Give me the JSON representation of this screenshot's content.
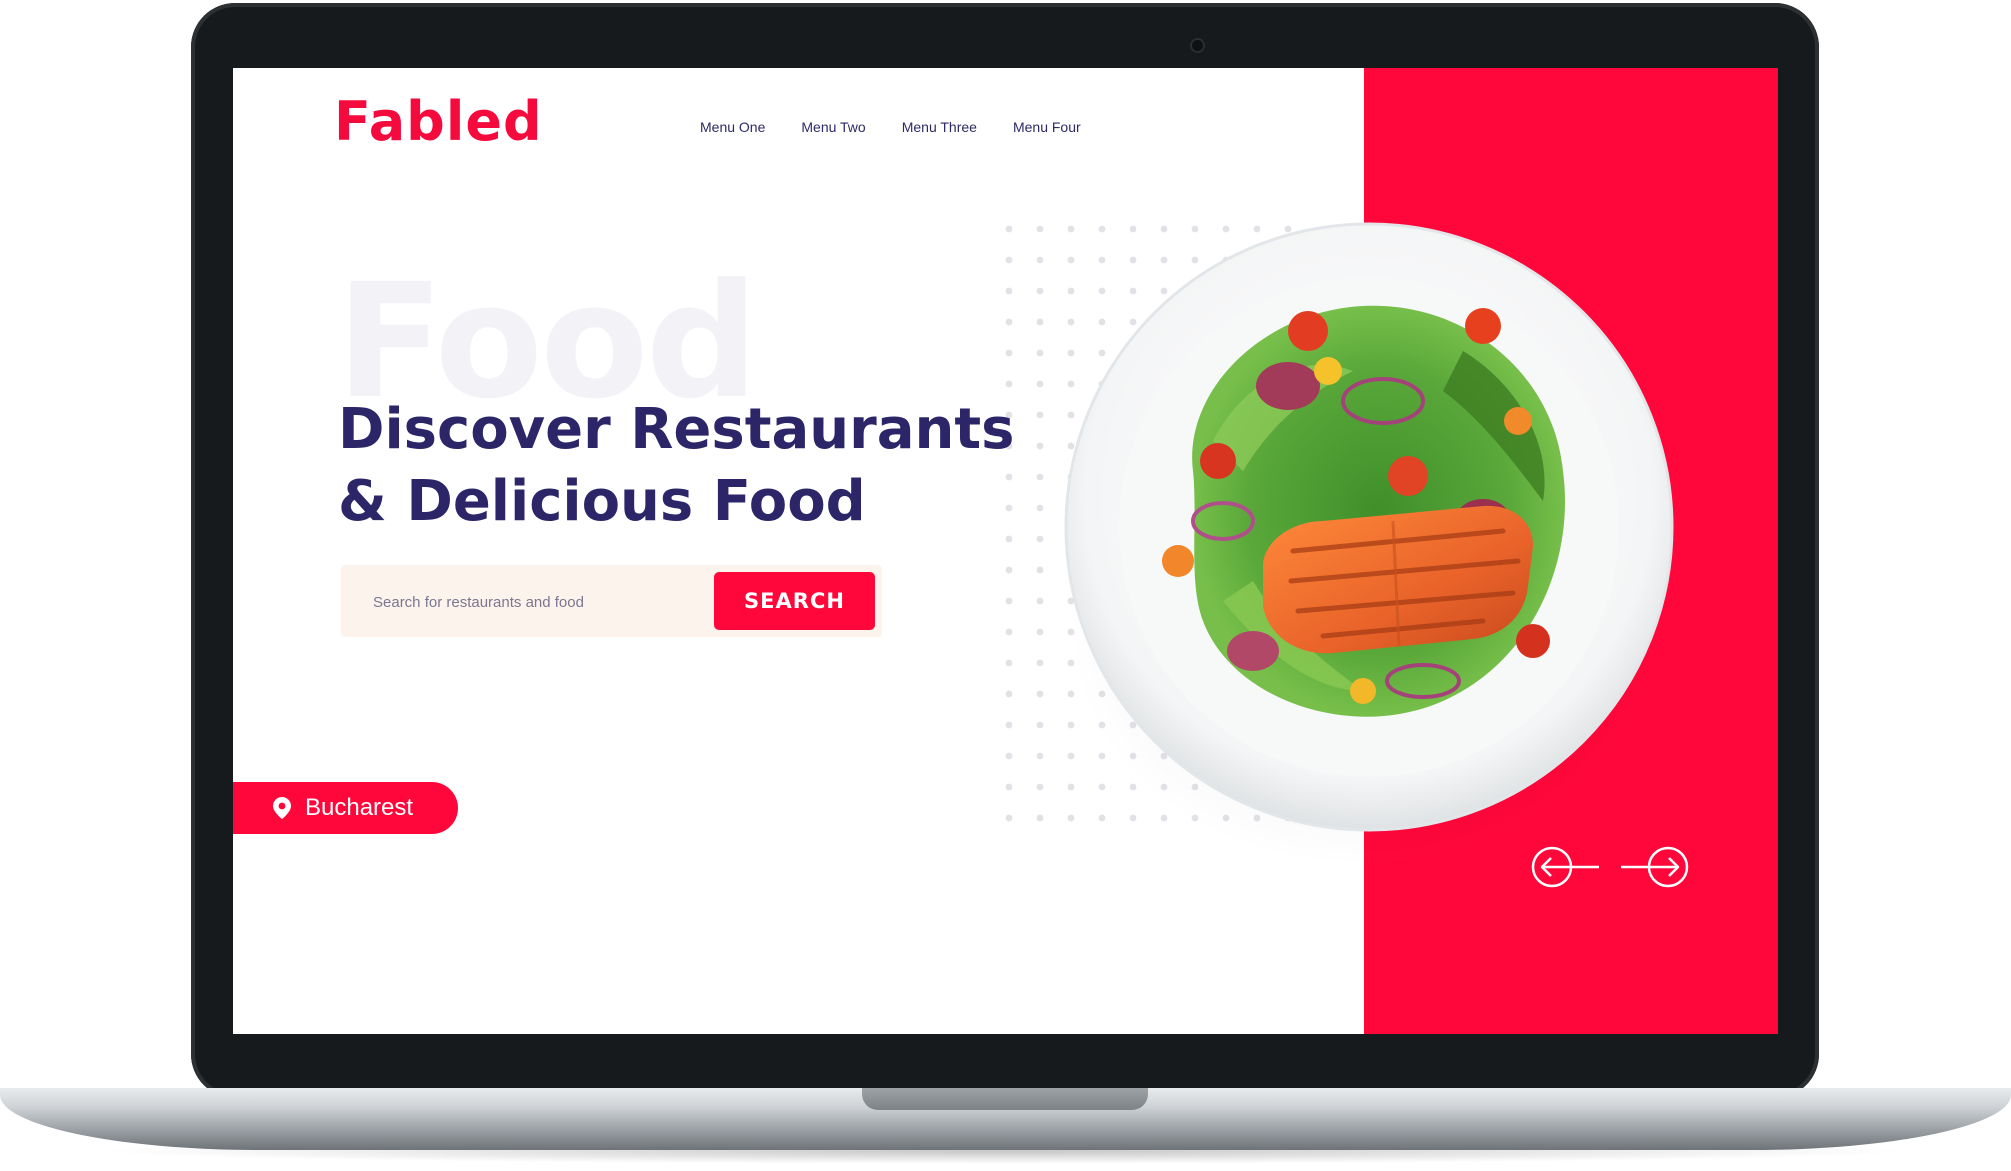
{
  "brand": {
    "name": "Fabled",
    "accent": "#ff073a",
    "navy": "#2c2568"
  },
  "nav": {
    "items": [
      {
        "label": "Menu One"
      },
      {
        "label": "Menu Two"
      },
      {
        "label": "Menu Three"
      },
      {
        "label": "Menu Four"
      }
    ]
  },
  "hero": {
    "background_word": "Food",
    "headline_line1": "Discover Restaurants",
    "headline_line2": "& Delicious Food"
  },
  "search": {
    "placeholder": "Search for restaurants and food",
    "button_label": "SEARCH"
  },
  "location": {
    "label": "Bucharest",
    "icon": "map-pin-icon"
  },
  "carousel": {
    "prev_icon": "arrow-left-circle-icon",
    "next_icon": "arrow-right-circle-icon"
  }
}
